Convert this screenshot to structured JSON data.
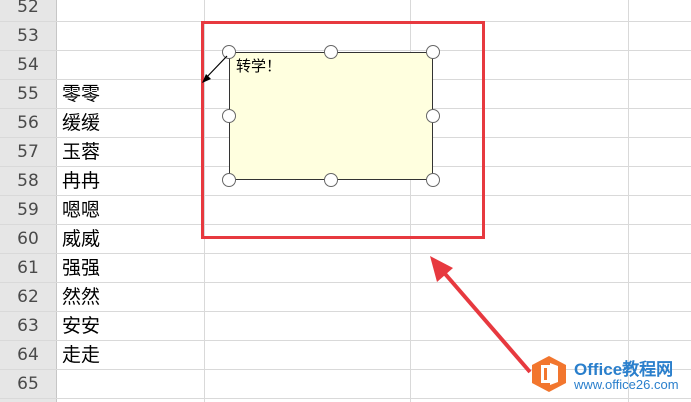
{
  "spreadsheet": {
    "rows": [
      {
        "num": "52",
        "a": ""
      },
      {
        "num": "53",
        "a": ""
      },
      {
        "num": "54",
        "a": ""
      },
      {
        "num": "55",
        "a": "零零"
      },
      {
        "num": "56",
        "a": "缓缓"
      },
      {
        "num": "57",
        "a": "玉蓉"
      },
      {
        "num": "58",
        "a": "冉冉"
      },
      {
        "num": "59",
        "a": "嗯嗯"
      },
      {
        "num": "60",
        "a": "威威"
      },
      {
        "num": "61",
        "a": "强强"
      },
      {
        "num": "62",
        "a": "然然"
      },
      {
        "num": "63",
        "a": "安安"
      },
      {
        "num": "64",
        "a": "走走"
      },
      {
        "num": "65",
        "a": ""
      }
    ]
  },
  "comment": {
    "text": "转学！",
    "fill_color": "#ffffdf"
  },
  "annotation": {
    "frame_color": "#e7393f",
    "arrow_color": "#e7393f"
  },
  "watermark": {
    "title": "Office教程网",
    "url": "www.office26.com",
    "brand_color": "#2a7fcc",
    "logo_icon": "office-logo-icon"
  }
}
